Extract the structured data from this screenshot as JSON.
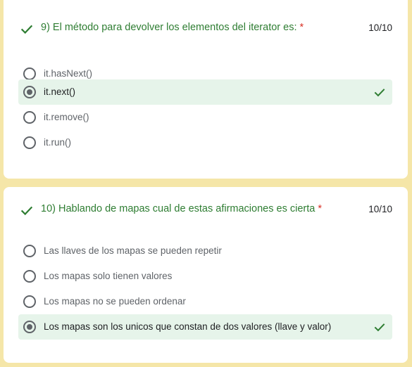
{
  "questions": [
    {
      "title": "9) El método para devolver los elementos del iterator es:",
      "required_mark": "*",
      "score": "10/10",
      "options": [
        {
          "label": "it.hasNext()"
        },
        {
          "label": "it.next()"
        },
        {
          "label": "it.remove()"
        },
        {
          "label": "it.run()"
        }
      ],
      "selected_index": 1
    },
    {
      "title": "10) Hablando de mapas cual de estas afirmaciones es cierta",
      "required_mark": "*",
      "score": "10/10",
      "options": [
        {
          "label": "Las llaves de los mapas se pueden repetir"
        },
        {
          "label": "Los mapas solo tienen valores"
        },
        {
          "label": "Los mapas no se pueden ordenar"
        },
        {
          "label": "Los mapas son los unicos que constan de dos valores (llave y valor)"
        }
      ],
      "selected_index": 3
    }
  ],
  "colors": {
    "page_background": "#f5e6a8",
    "correct_green": "#2e7d32",
    "selected_row": "#e6f4ea",
    "required_red": "#d93025"
  },
  "icons": {
    "question_status": "check-icon",
    "answer_status": "check-icon"
  }
}
